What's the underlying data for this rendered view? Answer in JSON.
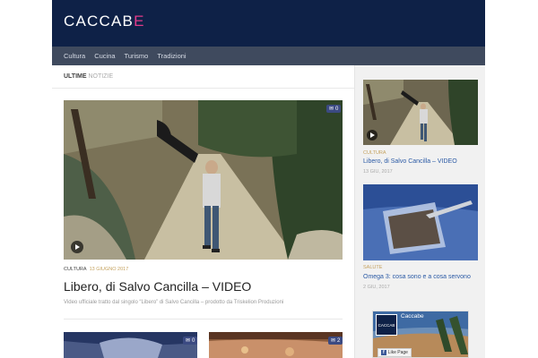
{
  "site": {
    "logo_text": "CACCAB",
    "logo_accent": "E",
    "brand_color": "#0e2147",
    "accent_color": "#e23b8a"
  },
  "nav": {
    "items": [
      {
        "label": "Cultura"
      },
      {
        "label": "Cucina"
      },
      {
        "label": "Turismo"
      },
      {
        "label": "Tradizioni"
      }
    ]
  },
  "main": {
    "section_bold": "ULTIME",
    "section_light": "NOTIZIE",
    "featured": {
      "comments": "0",
      "category": "CULTURA",
      "date": "13 GIUGNO 2017",
      "title": "Libero, di Salvo Cancilla – VIDEO",
      "excerpt": "Video ufficiale tratto dal singolo “Libero” di Salvo Cancilla – prodotto da Triskelion Produzioni"
    },
    "grid": [
      {
        "comments": "0"
      },
      {
        "comments": "2"
      }
    ]
  },
  "sidebar": {
    "posts": [
      {
        "category": "CULTURA",
        "title": "Libero, di Salvo Cancilla – VIDEO",
        "date": "13 GIU, 2017"
      },
      {
        "category": "SALUTE",
        "title": "Omega 3: cosa sono e a cosa servono",
        "date": "2 GIU, 2017"
      }
    ],
    "facebook": {
      "page_name": "Caccabe",
      "logo_text": "CACCAB",
      "like_label": "Like Page",
      "like_icon": "facebook-f-icon"
    }
  }
}
